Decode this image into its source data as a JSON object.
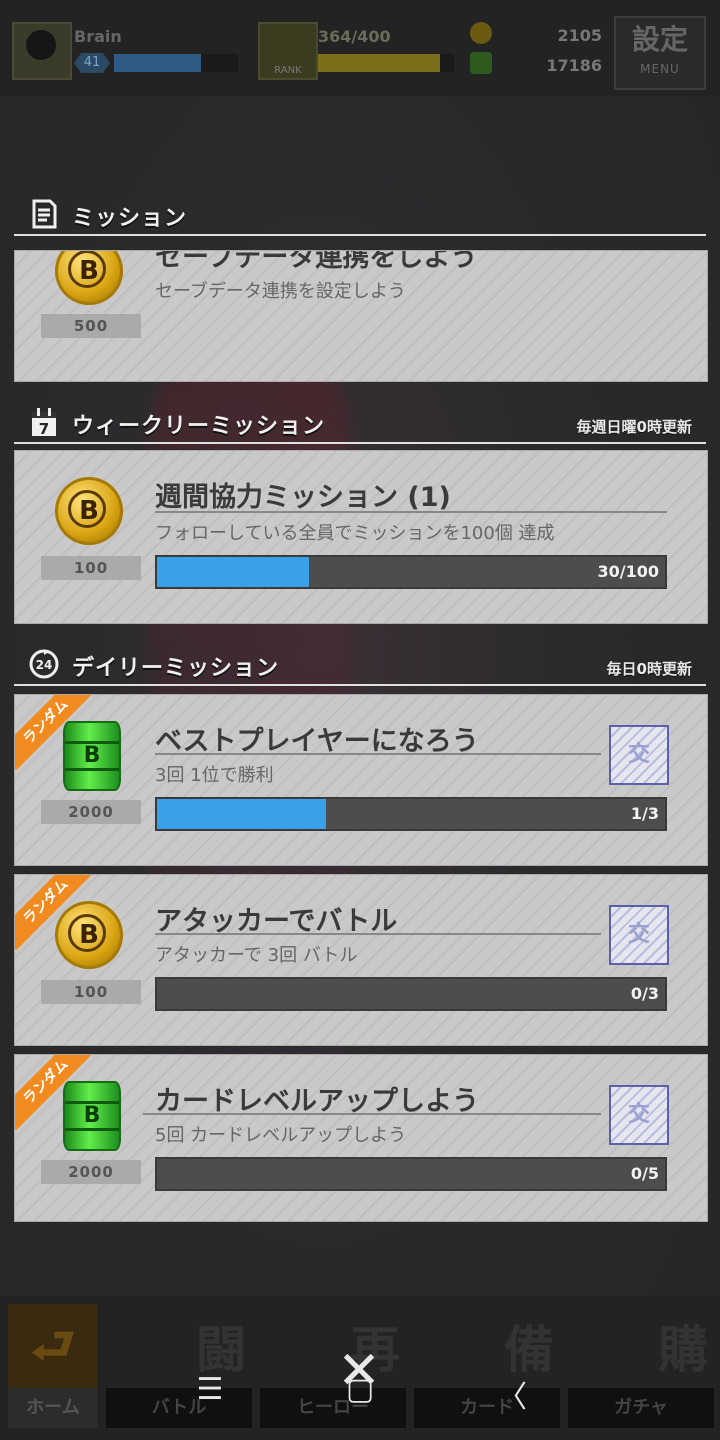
{
  "topbar": {
    "player_name": "Brain",
    "level": "41",
    "rank_label": "RANK",
    "stamina": "364/400",
    "currency1": "2105",
    "currency2": "17186",
    "settings_kanji": "設定",
    "settings_label": "MENU"
  },
  "section_mission": {
    "title": "ミッション"
  },
  "mission_partial": {
    "title": "セーブデータ連携をしよう",
    "desc": "セーブデータ連携を設定しよう",
    "reward_icon": "B",
    "reward": "500"
  },
  "section_weekly": {
    "title": "ウィークリーミッション",
    "note": "毎週日曜0時更新",
    "calendar_day": "7"
  },
  "weekly": [
    {
      "title": "週間協力ミッション (1)",
      "desc": "フォローしている全員でミッションを100個 達成",
      "reward_icon": "B",
      "reward": "100",
      "progress_text": "30/100",
      "progress": 0.3
    }
  ],
  "section_daily": {
    "title": "デイリーミッション",
    "note": "毎日0時更新",
    "clock_num": "24"
  },
  "daily": [
    {
      "tag": "ランダム",
      "title": "ベストプレイヤーになろう",
      "desc": "3回 1位で勝利",
      "reward_icon": "B",
      "reward": "2000",
      "reward_type": "green-can",
      "progress_text": "1/3",
      "progress": 0.333,
      "check_glyph": "交"
    },
    {
      "tag": "ランダム",
      "title": "アタッカーでバトル",
      "desc": "アタッカーで 3回 バトル",
      "reward_icon": "B",
      "reward": "100",
      "reward_type": "gold-coin",
      "progress_text": "0/3",
      "progress": 0,
      "check_glyph": "交"
    },
    {
      "tag": "ランダム",
      "title": "カードレベルアップしよう",
      "desc": "5回 カードレベルアップしよう",
      "reward_icon": "B",
      "reward": "2000",
      "reward_type": "green-can",
      "progress_text": "0/5",
      "progress": 0,
      "check_glyph": "交"
    }
  ],
  "nav": [
    {
      "big": "⮐",
      "label": "ホーム"
    },
    {
      "big": "闘",
      "label": "バトル"
    },
    {
      "big": "再",
      "label": "ヒーロー"
    },
    {
      "big": "備",
      "label": "カード"
    },
    {
      "big": "購",
      "label": "ガチャ"
    }
  ],
  "system": {
    "close": "✕",
    "menu": "☰",
    "home": "▢",
    "back": "〈"
  },
  "colors": {
    "progress_fill": "#3aa0e8",
    "random_tag": "#f18a1f",
    "card_bg": "#c9c9c9"
  }
}
